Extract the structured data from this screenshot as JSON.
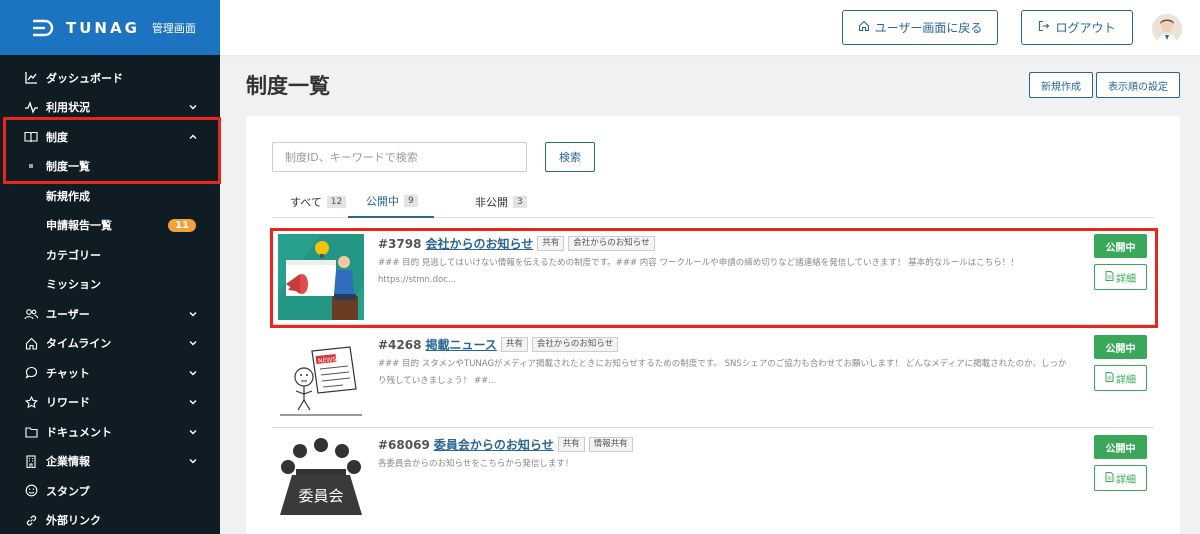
{
  "brand": {
    "logo_text": "TUNAG",
    "sub_title": "管理画面",
    "color": "#1c73c0"
  },
  "sidebar": {
    "items": [
      {
        "label": "ダッシュボード",
        "icon": "chart-icon",
        "chevron": ""
      },
      {
        "label": "利用状況",
        "icon": "activity-icon",
        "chevron": "down"
      },
      {
        "label": "制度",
        "icon": "book-icon",
        "chevron": "up"
      }
    ],
    "sub_items": [
      {
        "label": "制度一覧",
        "active": true
      },
      {
        "label": "新規作成"
      },
      {
        "label": "申請報告一覧",
        "badge": "11"
      },
      {
        "label": "カテゴリー"
      },
      {
        "label": "ミッション"
      }
    ],
    "items2": [
      {
        "label": "ユーザー",
        "icon": "users-icon"
      },
      {
        "label": "タイムライン",
        "icon": "home-icon"
      },
      {
        "label": "チャット",
        "icon": "chat-icon"
      },
      {
        "label": "リワード",
        "icon": "star-icon"
      },
      {
        "label": "ドキュメント",
        "icon": "folder-icon"
      },
      {
        "label": "企業情報",
        "icon": "building-icon"
      },
      {
        "label": "スタンプ",
        "icon": "smile-icon"
      },
      {
        "label": "外部リンク",
        "icon": "link-icon"
      }
    ]
  },
  "header": {
    "user_screen_label": "ユーザー画面に戻る",
    "logout_label": "ログアウト"
  },
  "page": {
    "title": "制度一覧",
    "new_label": "新規作成",
    "order_label": "表示順の設定"
  },
  "search": {
    "placeholder": "制度ID、キーワードで検索",
    "button_label": "検索"
  },
  "tabs": [
    {
      "label": "すべて",
      "count": "12"
    },
    {
      "label": "公開中",
      "count": "9",
      "active": true
    },
    {
      "label": "非公開",
      "count": "3"
    }
  ],
  "rows": [
    {
      "id": "#3798",
      "name": "会社からのお知らせ",
      "tags": [
        "共有",
        "会社からのお知らせ"
      ],
      "desc": "### 目的 見逃してはいけない情報を伝えるための制度です。### 内容 ワークルールや申請の締め切りなど諸連絡を発信していきます！ 基本的なルールはこちら！！ https://stmn.doc...",
      "status": "公開中",
      "detail": "詳細"
    },
    {
      "id": "#4268",
      "name": "掲載ニュース",
      "tags": [
        "共有",
        "会社からのお知らせ"
      ],
      "desc": "### 目的 スタメンやTUNAGがメディア掲載されたときにお知らせするための制度です。 SNSシェアのご協力も合わせてお願いします！ どんなメディアに掲載されたのか、しっかり残していきましょう！ ##...",
      "status": "公開中",
      "detail": "詳細"
    },
    {
      "id": "#68069",
      "name": "委員会からのお知らせ",
      "tags": [
        "共有",
        "情報共有"
      ],
      "desc": "各委員会からのお知らせをこちらから発信します！",
      "status": "公開中",
      "detail": "詳細",
      "thumb_text": "委員会"
    }
  ],
  "thumb_texts": {
    "news": "NEWS"
  },
  "colors": {
    "sidebar": "#0f1c24",
    "accent": "#2a6595",
    "status": "#3aa75b",
    "highlight": "#e8261c",
    "badge": "#f0a33c"
  }
}
